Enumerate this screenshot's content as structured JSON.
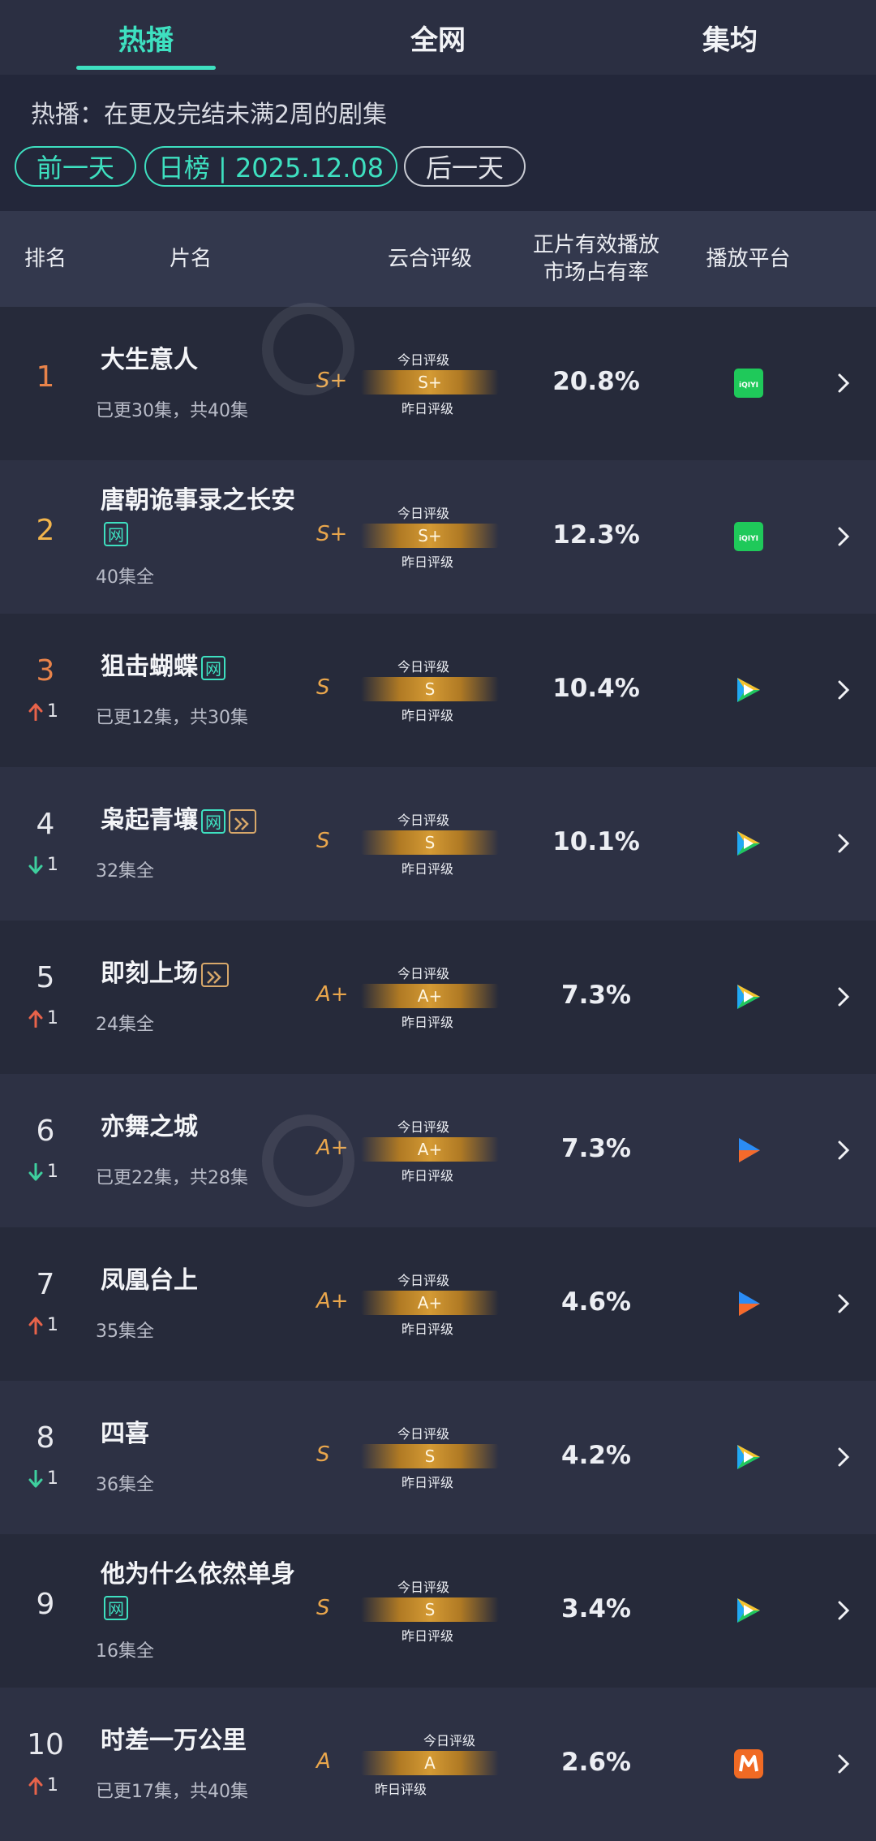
{
  "tabs": [
    "热播",
    "全网",
    "集均"
  ],
  "description": "热播：在更及完结未满2周的剧集",
  "date_nav": {
    "prev": "前一天",
    "current": "日榜 | 2025.12.08",
    "next": "后一天"
  },
  "columns": {
    "rank": "排名",
    "title": "片名",
    "grade": "云合评级",
    "share_line1": "正片有效播放",
    "share_line2": "市场占有率",
    "platform": "播放平台"
  },
  "gauge_labels": {
    "today": "今日评级",
    "yesterday": "昨日评级"
  },
  "net_badge": "网",
  "colors": {
    "accent": "#3ee0c0",
    "rank_top1": "#e8834a",
    "rank_top2": "#f1b44c",
    "rank_top3": "#e8834a",
    "up": "#e8634a",
    "down": "#3ecf9e",
    "grade": "#e9a64c"
  },
  "rows": [
    {
      "rank": "1",
      "title": "大生意人",
      "sub": "已更30集，共40集",
      "grade": "S+",
      "gauge": "S+",
      "share": "20.8%",
      "platform": "iqiyi-icon",
      "delta": null,
      "delta_value": "",
      "net": false,
      "ff": false
    },
    {
      "rank": "2",
      "title": "唐朝诡事录之长安",
      "sub": "40集全",
      "grade": "S+",
      "gauge": "S+",
      "share": "12.3%",
      "platform": "iqiyi-icon",
      "delta": null,
      "delta_value": "",
      "net": true,
      "ff": false
    },
    {
      "rank": "3",
      "title": "狙击蝴蝶",
      "sub": "已更12集，共30集",
      "grade": "S",
      "gauge": "S",
      "share": "10.4%",
      "platform": "tencent-video-icon",
      "delta": "up",
      "delta_value": "1",
      "net": true,
      "ff": false
    },
    {
      "rank": "4",
      "title": "枭起青壤",
      "sub": "32集全",
      "grade": "S",
      "gauge": "S",
      "share": "10.1%",
      "platform": "tencent-video-icon",
      "delta": "down",
      "delta_value": "1",
      "net": true,
      "ff": true
    },
    {
      "rank": "5",
      "title": "即刻上场",
      "sub": "24集全",
      "grade": "A+",
      "gauge": "A+",
      "share": "7.3%",
      "platform": "tencent-video-icon",
      "delta": "up",
      "delta_value": "1",
      "net": false,
      "ff": true
    },
    {
      "rank": "6",
      "title": "亦舞之城",
      "sub": "已更22集，共28集",
      "grade": "A+",
      "gauge": "A+",
      "share": "7.3%",
      "platform": "youku-icon",
      "delta": "down",
      "delta_value": "1",
      "net": false,
      "ff": false
    },
    {
      "rank": "7",
      "title": "凤凰台上",
      "sub": "35集全",
      "grade": "A+",
      "gauge": "A+",
      "share": "4.6%",
      "platform": "youku-icon",
      "delta": "up",
      "delta_value": "1",
      "net": false,
      "ff": false
    },
    {
      "rank": "8",
      "title": "四喜",
      "sub": "36集全",
      "grade": "S",
      "gauge": "S",
      "share": "4.2%",
      "platform": "tencent-video-icon",
      "delta": "down",
      "delta_value": "1",
      "net": false,
      "ff": false
    },
    {
      "rank": "9",
      "title": "他为什么依然单身",
      "sub": "16集全",
      "grade": "S",
      "gauge": "S",
      "share": "3.4%",
      "platform": "tencent-video-icon",
      "delta": null,
      "delta_value": "",
      "net": true,
      "ff": false
    },
    {
      "rank": "10",
      "title": "时差一万公里",
      "sub": "已更17集，共40集",
      "grade": "A",
      "gauge": "A",
      "share": "2.6%",
      "platform": "mango-tv-icon",
      "delta": "up",
      "delta_value": "1",
      "net": false,
      "ff": false
    }
  ]
}
